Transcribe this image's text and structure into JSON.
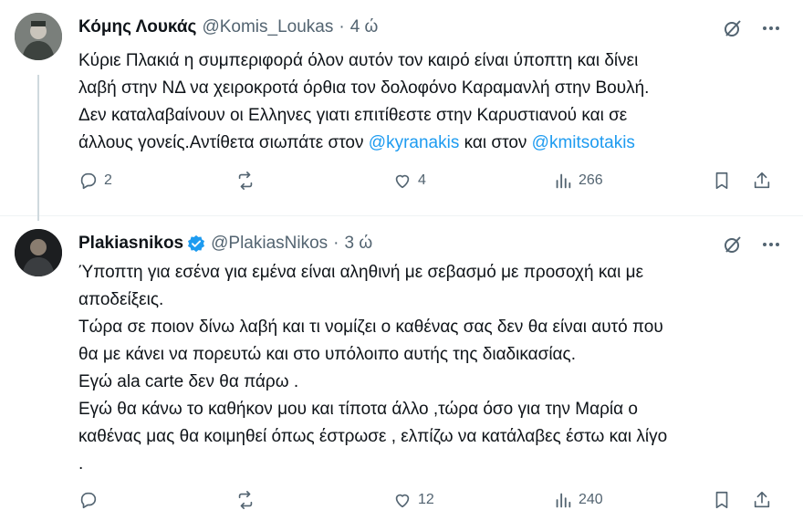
{
  "tweet1": {
    "author_name": "Κόμης Λουκάς",
    "handle": "@Komis_Loukas",
    "time": "4 ώ",
    "lines": [
      "Κύριε Πλακιά η συμπεριφορά όλον αυτόν τον καιρό είναι ύποπτη και δίνει",
      "λαβή στην ΝΔ να χειροκροτά όρθια τον δολοφόνο Καραμανλή στην Βουλή.",
      "Δεν καταλαβαίνουν οι Ελληνες γιατι επιτίθεστε στην Καρυστιανού και σε"
    ],
    "last_line_prefix": "άλλους γονείς.Αντίθετα σιωπάτε στον ",
    "mention1": "@kyranakis",
    "last_line_middle": " και στον ",
    "mention2": "@kmitsotakis",
    "replies": "2",
    "likes": "4",
    "views": "266"
  },
  "tweet2": {
    "author_name": "Plakiasnikos",
    "handle": "@PlakiasNikos",
    "time": "3 ώ",
    "lines": [
      "Ύποπτη για εσένα για εμένα είναι αληθινή με σεβασμό με προσοχή και με",
      "αποδείξεις.",
      "Τώρα σε ποιον δίνω λαβή και τι νομίζει ο καθένας σας δεν θα είναι αυτό που",
      "θα με κάνει να πορευτώ και στο υπόλοιπο αυτής της διαδικασίας.",
      "Εγώ ala carte δεν θα πάρω .",
      "Εγώ θα κάνω το καθήκον μου και τίποτα άλλο ,τώρα όσο για την Μαρία ο",
      "καθένας μας θα κοιμηθεί όπως έστρωσε , ελπίζω να κατάλαβες έστω και λίγο",
      "."
    ],
    "likes": "12",
    "views": "240"
  },
  "colors": {
    "text": "#0f1419",
    "secondary": "#536471",
    "link": "#1d9bf0",
    "verified": "#1d9bf0"
  }
}
